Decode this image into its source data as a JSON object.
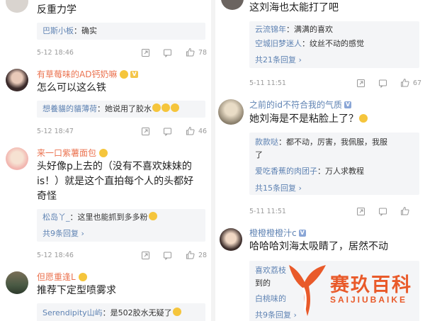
{
  "left": {
    "c0": {
      "text": "反重力学",
      "reply": {
        "user": "巴斯小板",
        "text": "：确实"
      },
      "time": "5-12 18:46",
      "likes": "78"
    },
    "c1": {
      "user": "有草莓味的AD钙奶嘛",
      "text": "怎么可以这么铁",
      "reply": {
        "user": "想養貓的貓薄荷",
        "text": "：她说用了胶水"
      },
      "time": "5-12 18:47",
      "likes": "46"
    },
    "c2": {
      "user": "来一口紫薯面包",
      "lines": [
        "头好像p上去的（没有不喜欢妹妹的",
        "is！）就是这个直拍每个人的头都好",
        "奇怪"
      ],
      "reply": {
        "user": "松岛丫_",
        "text": "：这里也能抓到多多粉"
      },
      "more": "共9条回复 ›",
      "time": "5-12 18:46",
      "likes": "28"
    },
    "c3": {
      "user": "但愿重逢L",
      "text": "推荐下定型喷雾求",
      "reply": {
        "user": "Serendipity山屿",
        "text": "：是502胶水无疑了"
      }
    }
  },
  "right": {
    "c0": {
      "text": "这刘海也太能打了吧",
      "replies": [
        {
          "user": "云流锦年",
          "text": "：满满的喜欢"
        },
        {
          "user": "空城旧梦迷人",
          "text": "：纹丝不动的感觉"
        }
      ],
      "more": "共21条回复 ›",
      "time": "5-11 11:51",
      "likes": "67"
    },
    "c1": {
      "user": "之前的id不符合我的气质",
      "text": "她刘海是不是粘脸上了？",
      "replies": [
        {
          "user": "款款哒",
          "text": "：都不动，厉害，我佩服，我服"
        },
        {
          "user": "",
          "text": "了"
        },
        {
          "user": "爱吃香蕉的肉团子",
          "text": "：万人求教程"
        }
      ],
      "more": "共15条回复 ›",
      "time": "5-11 11:51"
    },
    "c2": {
      "user": "橙橙橙橙汁c",
      "text": "哈哈哈刘海太吸睛了，居然不动",
      "replies": [
        {
          "user": "喜欢荔枝",
          "text": ""
        },
        {
          "user": "",
          "text": "到的"
        },
        {
          "user": "白桃味的",
          "text": ""
        }
      ],
      "more": "共9条回复 ›"
    }
  },
  "watermark": {
    "title": "赛玖百科",
    "subtitle": "SAIJIUBAIKE"
  },
  "colors": {
    "username_orange": "#eb7350",
    "link_blue": "#5f83b3",
    "reply_bg": "#f4f5f7",
    "brand": "#e95a2a"
  }
}
